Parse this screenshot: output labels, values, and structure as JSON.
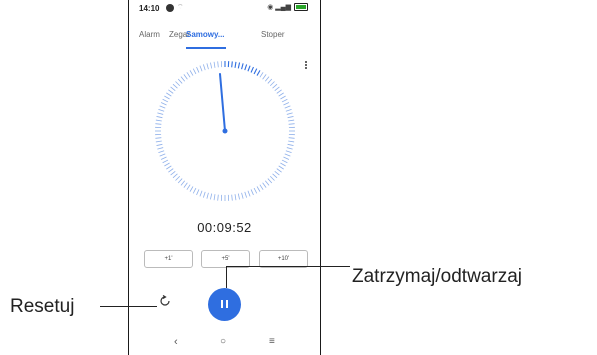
{
  "status_bar": {
    "time": "14:10"
  },
  "tabs": [
    {
      "label": "Alarm"
    },
    {
      "label": "Zegar"
    },
    {
      "label": "Samowy..."
    },
    {
      "label": "Stoper"
    }
  ],
  "timer": {
    "display": "00:09:52"
  },
  "add_buttons": [
    {
      "label": "+1'"
    },
    {
      "label": "+5'"
    },
    {
      "label": "+10'"
    }
  ],
  "icons": {
    "app_notification": "circle-dot-icon",
    "wifi": "wifi-icon",
    "battery": "battery-icon",
    "menu": "more-vert-icon",
    "reset": "reset-icon",
    "pause": "pause-icon",
    "nav_back": "back-icon",
    "nav_home": "home-icon",
    "nav_recents": "recents-icon"
  },
  "callouts": {
    "pause_play": "Zatrzymaj/odtwarzaj",
    "reset": "Resetuj"
  },
  "colors": {
    "accent": "#2f6ee0",
    "battery": "#2aa52a"
  }
}
